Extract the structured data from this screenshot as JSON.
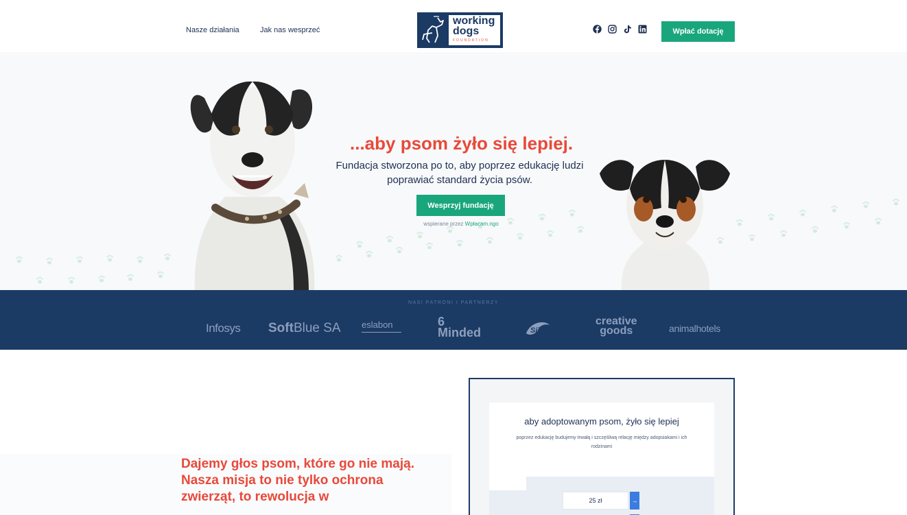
{
  "header": {
    "nav": [
      "Nasze działania",
      "Jak nas wesprzeć"
    ],
    "logo": {
      "line1": "working",
      "line2": "dogs",
      "line3": "FOUNDATION"
    },
    "social_icons": [
      "facebook-icon",
      "instagram-icon",
      "tiktok-icon",
      "linkedin-icon"
    ],
    "donate_label": "Wpłać dotację"
  },
  "hero": {
    "title": "...aby psom żyło się lepiej.",
    "subtitle": "Fundacja stworzona po to, aby poprzez edukację ludzi poprawiać standard życia psów.",
    "button_label": "Wesprzyj fundację",
    "supported_prefix": "wspierane przez",
    "supported_link": "Wpłacam.ngo"
  },
  "partners": {
    "title": "NASI PATRONI I PARTNERZY",
    "logos": [
      "Infosys",
      "SoftBlue SA",
      "eslabon",
      "6 Minded",
      "Sii",
      "creative goods",
      "animalhotels"
    ],
    "softblue_bold": "Soft",
    "softblue_rest": "Blue SA",
    "sixminded_line1": "6",
    "sixminded_line2": "Minded",
    "creative_line1": "creative",
    "creative_line2": "goods"
  },
  "mission": {
    "text": "Dajemy głos psom, które go nie mają. Nasza misja to nie tylko ochrona zwierząt, to rewolucja w"
  },
  "widget": {
    "title": "aby adoptowanym psom, żyło się lepiej",
    "description": "poprzez edukację budujemy trwałą i szczęśliwą relację między adopsiakami i ich rodzinami",
    "amount": "25 zł",
    "arrow": "→"
  },
  "colors": {
    "accent_red": "#e8493a",
    "accent_green": "#1aa67c",
    "navy": "#1b3a64"
  }
}
